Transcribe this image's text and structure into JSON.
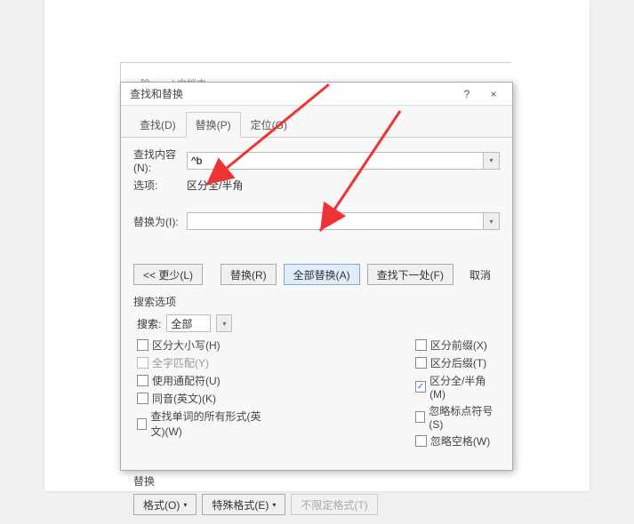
{
  "document": {
    "partial_text": "…除 word  文档内…"
  },
  "dialog": {
    "title": "查找和替换",
    "help": "?",
    "close": "×",
    "tabs": {
      "find": "查找(D)",
      "replace": "替换(P)",
      "goto": "定位(G)"
    },
    "find_label": "查找内容(N):",
    "find_value": "^b",
    "options_label": "选项:",
    "options_value": "区分全/半角",
    "replace_label": "替换为(I):",
    "replace_value": "",
    "buttons": {
      "less": "<< 更少(L)",
      "replace": "替换(R)",
      "replace_all": "全部替换(A)",
      "find_next": "查找下一处(F)",
      "cancel": "取消"
    },
    "search_options_title": "搜索选项",
    "search_label": "搜索:",
    "search_value": "全部",
    "checks_left": {
      "case": "区分大小写(H)",
      "wholeword": "全字匹配(Y)",
      "wildcard": "使用通配符(U)",
      "sounds": "同音(英文)(K)",
      "allforms": "查找单词的所有形式(英文)(W)"
    },
    "checks_right": {
      "prefix": "区分前缀(X)",
      "suffix": "区分后缀(T)",
      "fullhalf": "区分全/半角(M)",
      "punct": "忽略标点符号(S)",
      "space": "忽略空格(W)"
    },
    "replace_section_title": "替换",
    "bottom": {
      "format": "格式(O)",
      "special": "特殊格式(E)",
      "noformat": "不限定格式(T)"
    }
  }
}
